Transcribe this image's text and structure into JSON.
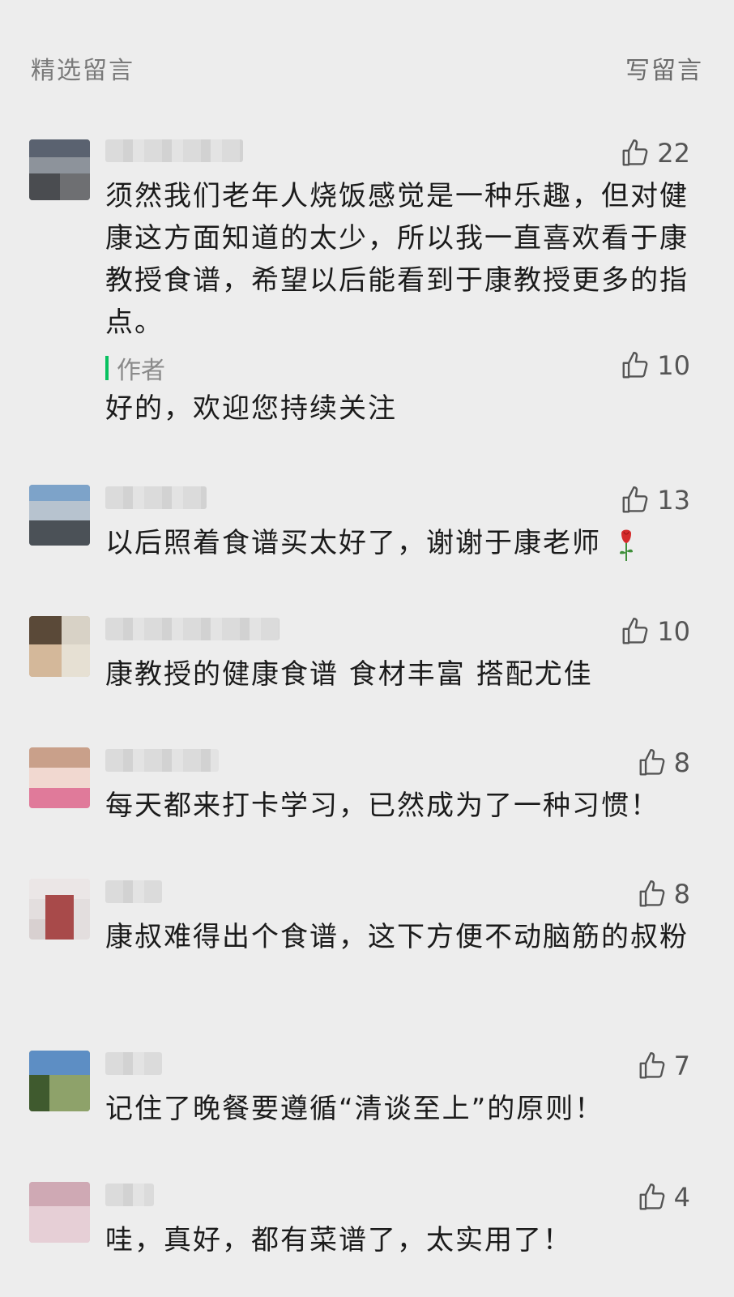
{
  "header": {
    "title": "精选留言",
    "write_label": "写留言"
  },
  "comments": [
    {
      "likes": "22",
      "text": "须然我们老年人烧饭感觉是一种乐趣，但对健康这方面知道的太少，所以我一直喜欢看于康教授食谱，希望以后能看到于康教授更多的指点。",
      "reply": {
        "author_label": "作者",
        "likes": "10",
        "text": "好的，欢迎您持续关注"
      }
    },
    {
      "likes": "13",
      "text": "以后照着食谱买太好了，谢谢于康老师"
    },
    {
      "likes": "10",
      "text": "康教授的健康食谱 食材丰富 搭配尤佳"
    },
    {
      "likes": "8",
      "text": "每天都来打卡学习，已然成为了一种习惯！"
    },
    {
      "likes": "8",
      "text": "康叔难得出个食谱，这下方便不动脑筋的叔粉"
    },
    {
      "likes": "7",
      "text": "记住了晚餐要遵循“清谈至上”的原则！"
    },
    {
      "likes": "4",
      "text": "哇，真好，都有菜谱了，太实用了！"
    }
  ],
  "colors": {
    "accent": "#07c160",
    "background": "#ededed"
  },
  "icons": {
    "like": "thumbs-up-icon",
    "emoji": "rose-icon"
  }
}
